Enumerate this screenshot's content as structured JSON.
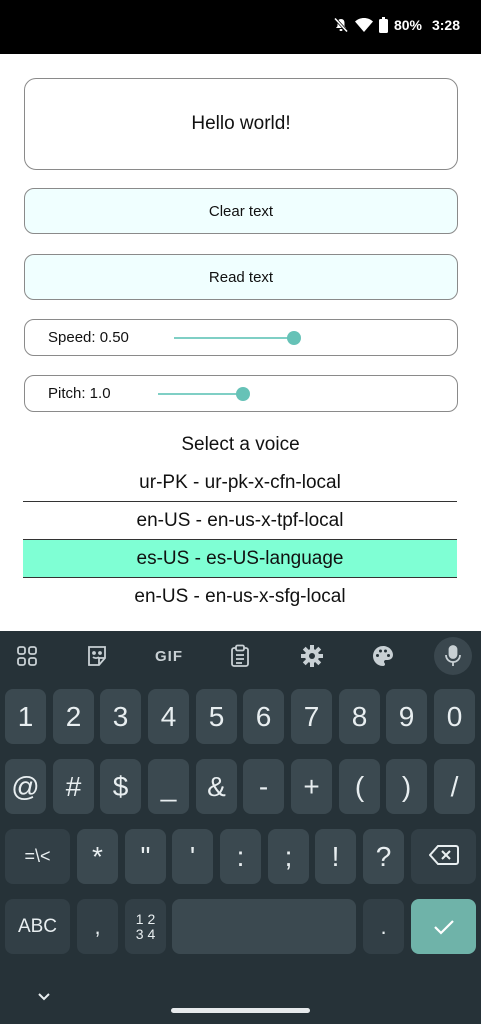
{
  "status_bar": {
    "battery": "80%",
    "time": "3:28"
  },
  "text_box": {
    "value": "Hello world!"
  },
  "buttons": {
    "clear": "Clear text",
    "read": "Read text"
  },
  "speed": {
    "label": "Speed: 0.50",
    "level": 0.65
  },
  "pitch": {
    "label": "Pitch: 1.0",
    "level": 0.5
  },
  "voice": {
    "title": "Select a voice",
    "items": [
      "ur-PK - ur-pk-x-cfn-local",
      "en-US - en-us-x-tpf-local",
      "es-US - es-US-language",
      "en-US - en-us-x-sfg-local"
    ],
    "selected_index": 2
  },
  "keyboard": {
    "toolbar_icons": [
      "apps-grid-icon",
      "sticker-icon",
      "gif-icon",
      "clipboard-icon",
      "settings-icon",
      "palette-icon",
      "mic-icon"
    ],
    "gif_label": "GIF",
    "row1": [
      "1",
      "2",
      "3",
      "4",
      "5",
      "6",
      "7",
      "8",
      "9",
      "0"
    ],
    "row2": [
      "@",
      "#",
      "$",
      "_",
      "&",
      "-",
      "+",
      "(",
      ")",
      "/"
    ],
    "row3": [
      "=\\<",
      "*",
      "\"",
      "'",
      ":",
      ";",
      "!",
      "?"
    ],
    "abc_label": "ABC",
    "comma": ",",
    "numpad_label_top": "1 2",
    "numpad_label_bottom": "3 4",
    "period": "."
  }
}
